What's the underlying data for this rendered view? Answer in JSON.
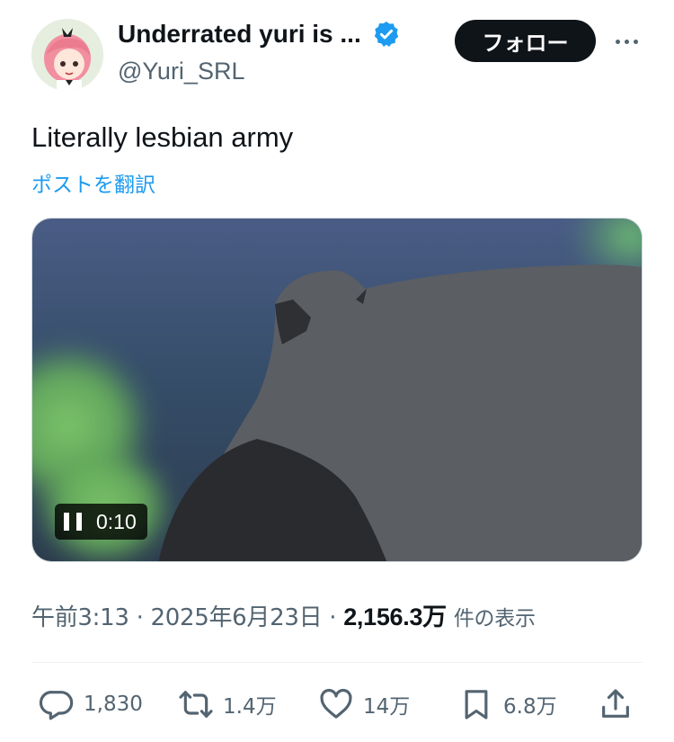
{
  "author": {
    "display_name": "Underrated yuri is ...",
    "handle": "@Yuri_SRL"
  },
  "follow_button_label": "フォロー",
  "tweet": {
    "text": "Literally lesbian army",
    "translate_link": "ポストを翻訳"
  },
  "video": {
    "time": "0:10"
  },
  "meta": {
    "time": "午前3:13",
    "separator": "·",
    "date": "2025年6月23日",
    "views": "2,156.3万",
    "views_label": "件の表示"
  },
  "actions": {
    "replies": "1,830",
    "reposts": "1.4万",
    "likes": "14万",
    "bookmarks": "6.8万"
  },
  "colors": {
    "accent": "#1d9bf0",
    "text_primary": "#0f1419",
    "text_secondary": "#536471",
    "button_bg": "#0f1419"
  }
}
